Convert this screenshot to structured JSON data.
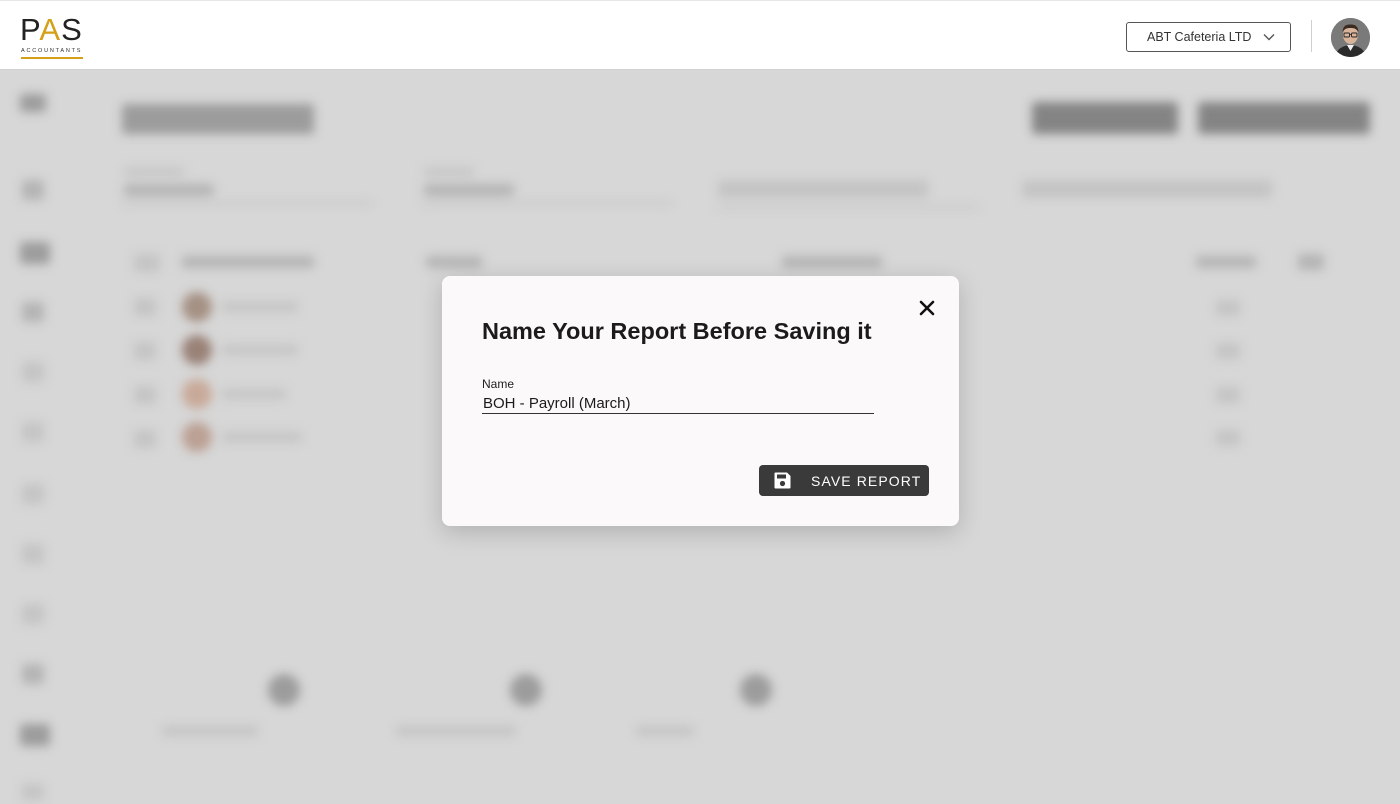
{
  "header": {
    "logo_main": "PAS",
    "logo_sub": "ACCOUNTANTS",
    "company_select": "ABT Cafeteria LTD",
    "avatar_alt": "user-avatar"
  },
  "dialog": {
    "title": "Name Your Report Before Saving it",
    "field_label": "Name",
    "field_value": "BOH - Payroll (March)",
    "save_label": "SAVE REPORT"
  },
  "colors": {
    "accent": "#d4a017",
    "button_bg": "#3a3a3a",
    "dialog_bg": "#fcf9fa",
    "backdrop": "#dcdcdc"
  },
  "icons": {
    "close": "close-icon",
    "save": "floppy-disk-icon",
    "chevron": "chevron-down-icon"
  }
}
